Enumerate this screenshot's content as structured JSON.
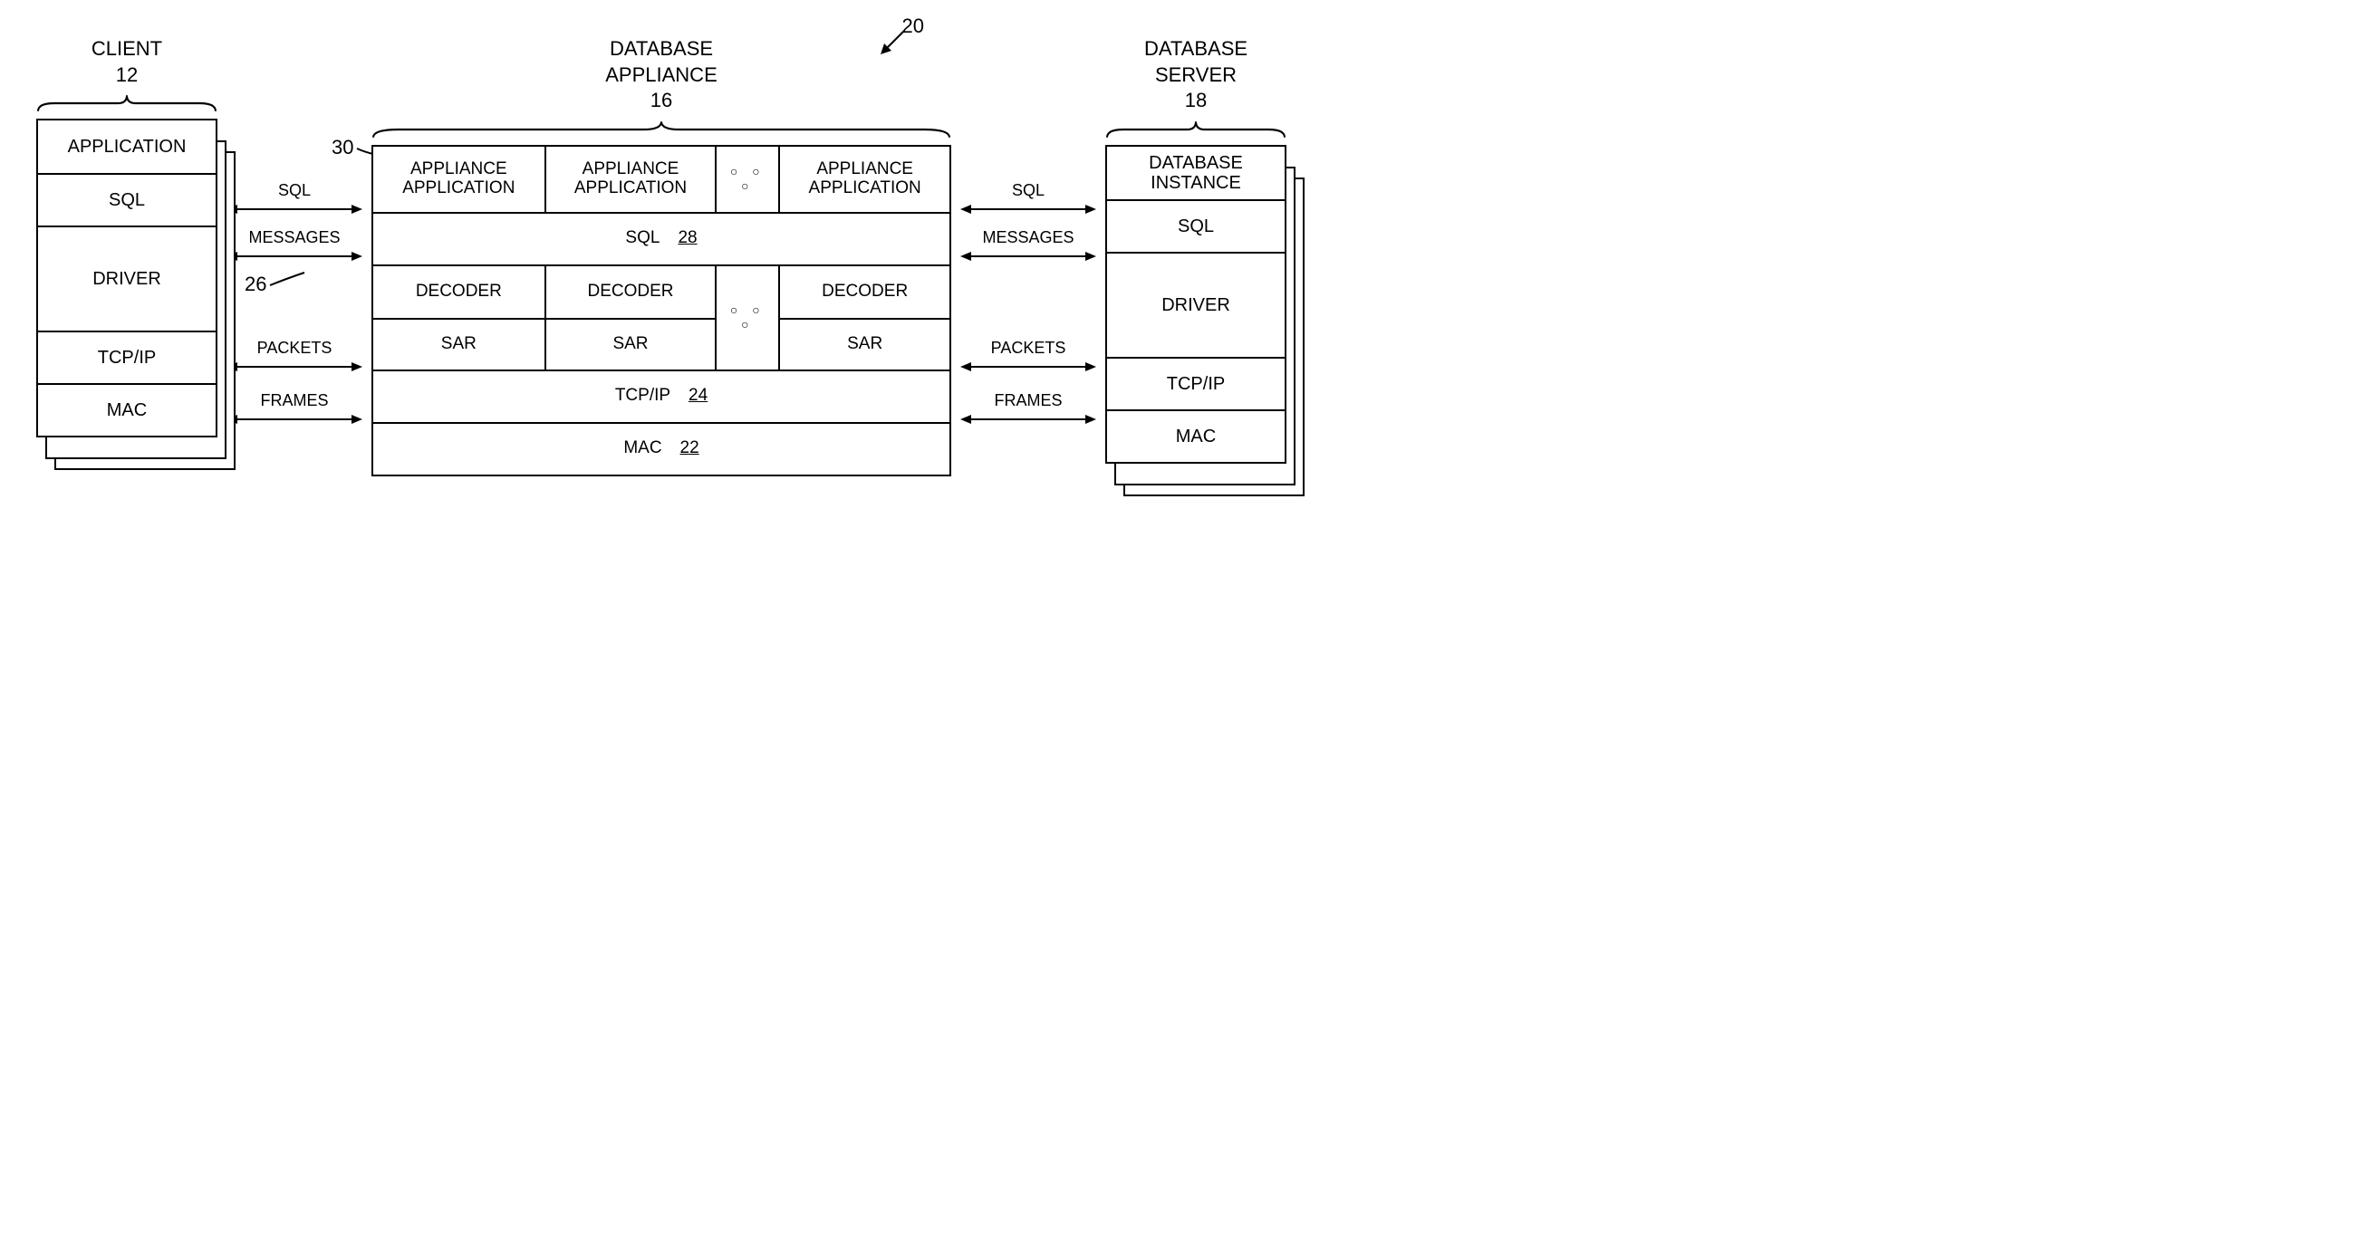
{
  "refnum_system": "20",
  "client": {
    "title": "CLIENT",
    "num": "12",
    "layers": [
      "APPLICATION",
      "SQL",
      "DRIVER",
      "TCP/IP",
      "MAC"
    ]
  },
  "appliance": {
    "title": "DATABASE\nAPPLIANCE",
    "num": "16",
    "refnum_apps": "30",
    "refnum_driver": "26",
    "apps": [
      "APPLIANCE APPLICATION",
      "APPLIANCE APPLICATION",
      "APPLIANCE APPLICATION"
    ],
    "sql": {
      "label": "SQL",
      "num": "28"
    },
    "driver": {
      "decoder": "DECODER",
      "sar": "SAR"
    },
    "tcpip": {
      "label": "TCP/IP",
      "num": "24"
    },
    "mac": {
      "label": "MAC",
      "num": "22"
    }
  },
  "server": {
    "title": "DATABASE\nSERVER",
    "num": "18",
    "layers": [
      "DATABASE INSTANCE",
      "SQL",
      "DRIVER",
      "TCP/IP",
      "MAC"
    ]
  },
  "links": {
    "sql": "SQL",
    "messages": "MESSAGES",
    "packets": "PACKETS",
    "frames": "FRAMES"
  },
  "ellipsis": "○ ○ ○"
}
